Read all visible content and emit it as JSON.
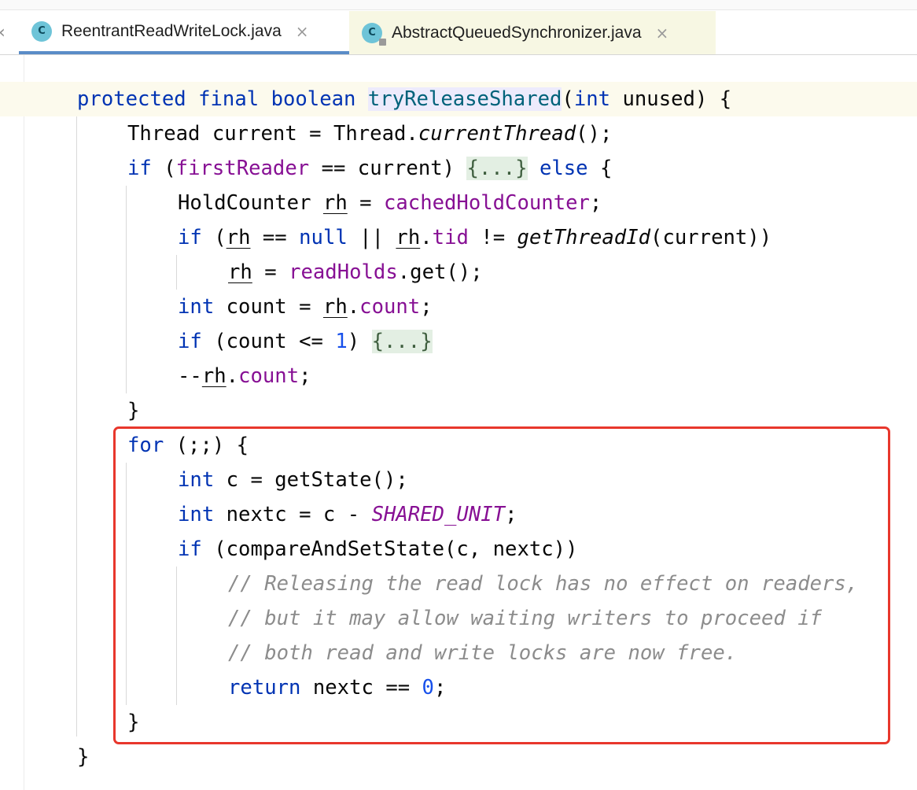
{
  "tabs": [
    {
      "icon": "C",
      "label": "ReentrantReadWriteLock.java",
      "close": "×",
      "active": true
    },
    {
      "icon": "C",
      "label": "AbstractQueuedSynchronizer.java",
      "close": "×",
      "active": false
    }
  ],
  "nav": {
    "left_arrow": "‹"
  },
  "code": {
    "l1": {
      "a": "protected",
      "b": " ",
      "c": "final",
      "d": " ",
      "e": "boolean",
      "f": " ",
      "g": "tryReleaseShared",
      "h": "(",
      "i": "int",
      "j": " unused) {"
    },
    "l2": {
      "a": "Thread current = Thread.",
      "b": "currentThread",
      "c": "();"
    },
    "l3": {
      "a": "if",
      "b": " (",
      "c": "firstReader",
      "d": " == current) ",
      "e": "{...}",
      "f": " ",
      "g": "else",
      "h": " {"
    },
    "l4": {
      "a": "HoldCounter ",
      "b": "rh",
      "c": " = ",
      "d": "cachedHoldCounter",
      "e": ";"
    },
    "l5": {
      "a": "if",
      "b": " (",
      "c": "rh",
      "d": " == ",
      "e": "null",
      "f": " || ",
      "g": "rh",
      "h": ".",
      "i": "tid",
      "j": " != ",
      "k": "getThreadId",
      "l": "(current))"
    },
    "l6": {
      "a": "rh",
      "b": " = ",
      "c": "readHolds",
      "d": ".get();"
    },
    "l7": {
      "a": "int",
      "b": " count = ",
      "c": "rh",
      "d": ".",
      "e": "count",
      "f": ";"
    },
    "l8": {
      "a": "if",
      "b": " (count <= ",
      "c": "1",
      "d": ") ",
      "e": "{...}"
    },
    "l9": {
      "a": "--",
      "b": "rh",
      "c": ".",
      "d": "count",
      "e": ";"
    },
    "l10": {
      "a": "}"
    },
    "l11": {
      "a": "for",
      "b": " (;;) {"
    },
    "l12": {
      "a": "int",
      "b": " c = getState();"
    },
    "l13": {
      "a": "int",
      "b": " nextc = c - ",
      "c": "SHARED_UNIT",
      "d": ";"
    },
    "l14": {
      "a": "if",
      "b": " (compareAndSetState(c, nextc))"
    },
    "l15": {
      "a": "// Releasing the read lock has no effect on readers,"
    },
    "l16": {
      "a": "// but it may allow waiting writers to proceed if"
    },
    "l17": {
      "a": "// both read and write locks are now free."
    },
    "l18": {
      "a": "return",
      "b": " nextc == ",
      "c": "0",
      "d": ";"
    },
    "l19": {
      "a": "}"
    },
    "l20": {
      "a": "}"
    }
  },
  "colors": {
    "highlight_box": "#e8372c",
    "keyword": "#0033b3",
    "field": "#871094",
    "comment": "#8c8c8c",
    "number": "#1750eb",
    "method_decl": "#00627a"
  }
}
